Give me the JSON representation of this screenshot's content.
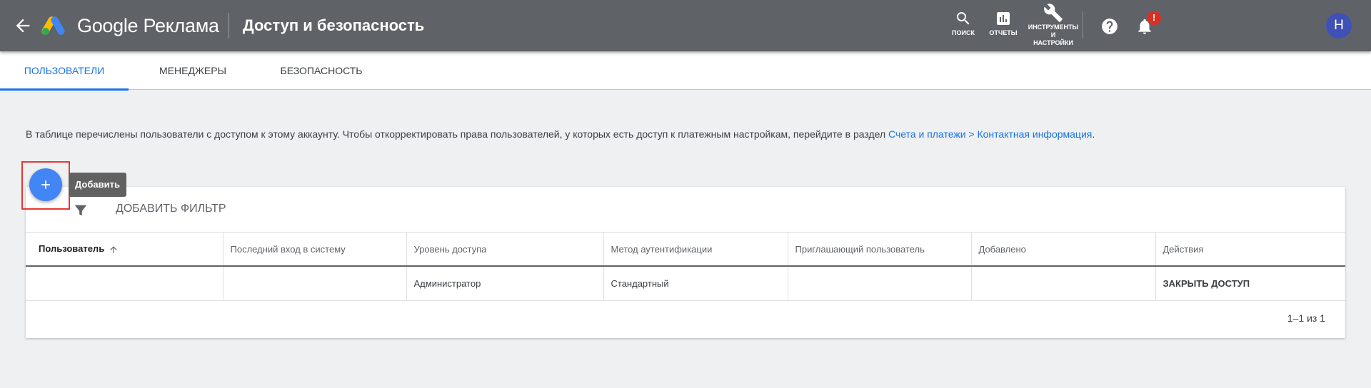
{
  "header": {
    "brand": "Google Реклама",
    "page_title": "Доступ и безопасность",
    "tools": {
      "search_label": "поиск",
      "reports_label": "отчеты",
      "tools_label_1": "инструменты",
      "tools_label_2": "и",
      "tools_label_3": "настройки"
    },
    "notification_badge": "!",
    "avatar_letter": "Н"
  },
  "tabs": [
    {
      "label": "Пользователи",
      "active": true
    },
    {
      "label": "Менеджеры",
      "active": false
    },
    {
      "label": "Безопасность",
      "active": false
    }
  ],
  "description": {
    "text": "В таблице перечислены пользователи с доступом к этому аккаунту. Чтобы откорректировать права пользователей, у которых есть доступ к платежным настройкам, перейдите в раздел ",
    "link": "Счета и платежи > Контактная информация",
    "suffix": "."
  },
  "fab": {
    "tooltip": "Добавить"
  },
  "filter": {
    "label": "Добавить фильтр"
  },
  "table": {
    "columns": [
      "Пользователь",
      "Последний вход в систему",
      "Уровень доступа",
      "Метод аутентификации",
      "Приглашающий пользователь",
      "Добавлено",
      "Действия"
    ],
    "rows": [
      {
        "user": "",
        "last_login": "",
        "access_level": "Администратор",
        "auth_method": "Стандартный",
        "inviter": "",
        "added": "",
        "action": "Закрыть доступ"
      }
    ]
  },
  "pagination": "1–1 из 1",
  "colors": {
    "header_bg": "#5f6368",
    "accent": "#1a73e8",
    "fab": "#4285f4",
    "highlight": "#e53935",
    "badge": "#d93025"
  }
}
